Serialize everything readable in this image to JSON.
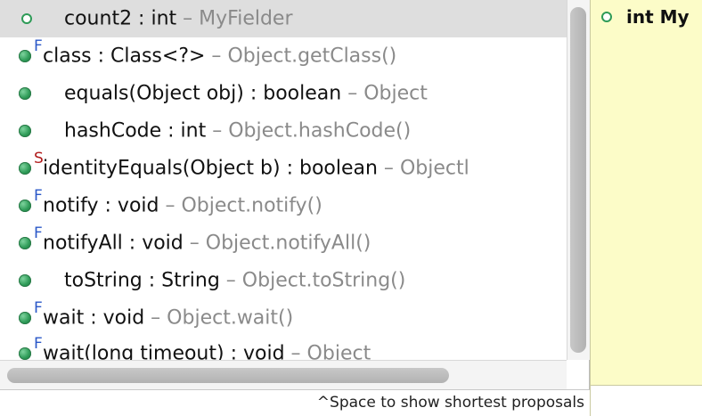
{
  "proposals": [
    {
      "label": "count2 : int",
      "owner": "MyFielder",
      "modifier": "",
      "icon": "field-icon",
      "selected": true
    },
    {
      "label": "class : Class<?>",
      "owner": "Object.getClass()",
      "modifier": "F",
      "icon": "public-method-icon"
    },
    {
      "label": "equals(Object obj) : boolean",
      "owner": "Object",
      "modifier": "",
      "icon": "public-method-icon"
    },
    {
      "label": "hashCode : int",
      "owner": "Object.hashCode()",
      "modifier": "",
      "icon": "public-method-icon"
    },
    {
      "label": "identityEquals(Object b) : boolean",
      "owner": "Objectl",
      "modifier": "S",
      "icon": "public-method-icon"
    },
    {
      "label": "notify : void",
      "owner": "Object.notify()",
      "modifier": "F",
      "icon": "public-method-icon"
    },
    {
      "label": "notifyAll : void",
      "owner": "Object.notifyAll()",
      "modifier": "F",
      "icon": "public-method-icon"
    },
    {
      "label": "toString : String",
      "owner": "Object.toString()",
      "modifier": "",
      "icon": "public-method-icon"
    },
    {
      "label": "wait : void",
      "owner": "Object.wait()",
      "modifier": "F",
      "icon": "public-method-icon"
    },
    {
      "label": "wait(long timeout) : void",
      "owner": "Object",
      "modifier": "F",
      "icon": "public-method-icon"
    }
  ],
  "separator": " – ",
  "status": {
    "hint": "^Space to show shortest proposals"
  },
  "info_panel": {
    "text": "int My",
    "icon": "field-icon"
  },
  "colors": {
    "selected_row": "#dedede",
    "owner_text": "#8a8a8a",
    "info_background": "#fcfcc8",
    "final_modifier": "#2b58c8",
    "static_modifier": "#b01b1b"
  }
}
